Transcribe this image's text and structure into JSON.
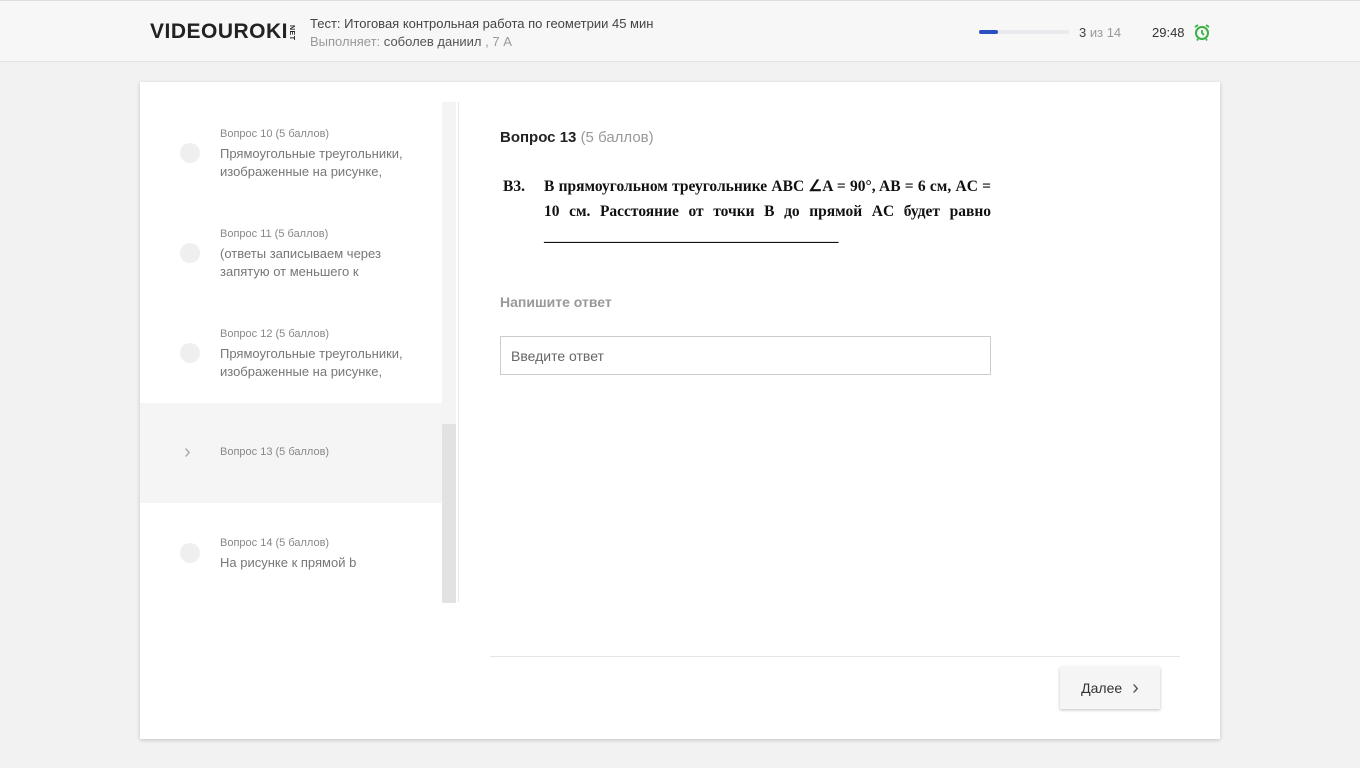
{
  "header": {
    "logo": "VIDEOUROKI",
    "logo_suffix": "NET",
    "test_title": "Тест: Итоговая контрольная работа по геометрии 45 мин",
    "performer_label": "Выполняет:",
    "performer_name": "соболев даниил",
    "performer_class": ", 7 А",
    "progress_fraction": 0.21,
    "count_current": "3",
    "count_rest": "из 14",
    "timer": "29:48",
    "accent": "#2a4fbf",
    "timer_icon_color": "#3cb043"
  },
  "sidebar": {
    "items": [
      {
        "header": "Вопрос 10 (5 баллов)",
        "text": "Прямоугольные треугольники, изображенные на рисунке,"
      },
      {
        "header": "Вопрос 11 (5 баллов)",
        "text": "(ответы записываем через запятую от меньшего к"
      },
      {
        "header": "Вопрос 12 (5 баллов)",
        "text": "Прямоугольные треугольники, изображенные на рисунке,"
      },
      {
        "header": "Вопрос 13 (5 баллов)",
        "text": ""
      },
      {
        "header": "Вопрос 14 (5 баллов)",
        "text": "На рисунке к прямой b"
      }
    ]
  },
  "question": {
    "title": "Вопрос 13",
    "points": "(5 баллов)",
    "label": "B3.",
    "text": "В прямоугольном треугольнике ABC ∠A = 90°, AB = 6 см, AC = 10 см. Расстояние от точки B до прямой AC будет равно ______________________________________",
    "answer_label": "Напишите ответ",
    "answer_placeholder": "Введите ответ",
    "answer_value": ""
  },
  "footer": {
    "next_label": "Далее"
  }
}
